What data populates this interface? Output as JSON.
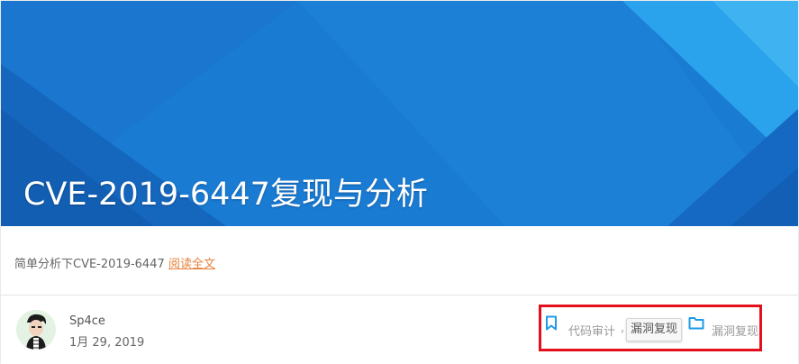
{
  "post": {
    "title": "CVE-2019-6447复现与分析",
    "excerpt": "简单分析下CVE-2019-6447",
    "read_more": "阅读全文",
    "author": "Sp4ce",
    "date": "1月 29, 2019",
    "tags": [
      "代码审计",
      "漏洞复现"
    ],
    "tag_separator": ",",
    "category": "漏洞复现"
  },
  "colors": {
    "hero_blue": "#1e7fd6",
    "link_orange": "#e8823f",
    "meta_icon_blue": "#1e9be8",
    "highlight_red": "#e3101b"
  },
  "icons": {
    "tag": "bookmark-icon",
    "category": "folder-icon"
  }
}
